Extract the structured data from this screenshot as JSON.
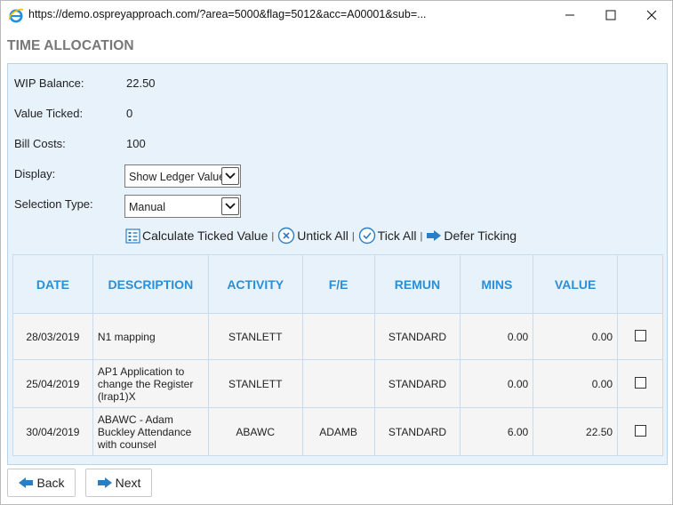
{
  "window": {
    "url": "https://demo.ospreyapproach.com/?area=5000&flag=5012&acc=A00001&sub=..."
  },
  "page": {
    "title": "TIME ALLOCATION"
  },
  "summary": {
    "wip_label": "WIP Balance:",
    "wip_value": "22.50",
    "ticked_label": "Value Ticked:",
    "ticked_value": "0",
    "costs_label": "Bill Costs:",
    "costs_value": "100"
  },
  "display": {
    "label": "Display:",
    "selected": "Show Ledger Values"
  },
  "selection": {
    "label": "Selection Type:",
    "selected": "Manual"
  },
  "actions": {
    "calculate": "Calculate Ticked Value",
    "untick": "Untick All",
    "tick": "Tick All",
    "defer": "Defer Ticking",
    "separator": "|"
  },
  "table": {
    "headers": [
      "DATE",
      "DESCRIPTION",
      "ACTIVITY",
      "F/E",
      "REMUN",
      "MINS",
      "VALUE"
    ],
    "rows": [
      {
        "date": "28/03/2019",
        "description": "N1 mapping",
        "activity": "STANLETT",
        "fe": "",
        "remun": "STANDARD",
        "mins": "0.00",
        "value": "0.00",
        "ticked": false
      },
      {
        "date": "25/04/2019",
        "description": "AP1 Application to change the Register (lrap1)X",
        "activity": "STANLETT",
        "fe": "",
        "remun": "STANDARD",
        "mins": "0.00",
        "value": "0.00",
        "ticked": false
      },
      {
        "date": "30/04/2019",
        "description": "ABAWC - Adam Buckley Attendance with counsel",
        "activity": "ABAWC",
        "fe": "ADAMB",
        "remun": "STANDARD",
        "mins": "6.00",
        "value": "22.50",
        "ticked": false
      }
    ]
  },
  "nav": {
    "back": "Back",
    "next": "Next"
  },
  "colors": {
    "accent": "#2a8fd6",
    "panel": "#e8f2fb",
    "title": "#777777"
  }
}
